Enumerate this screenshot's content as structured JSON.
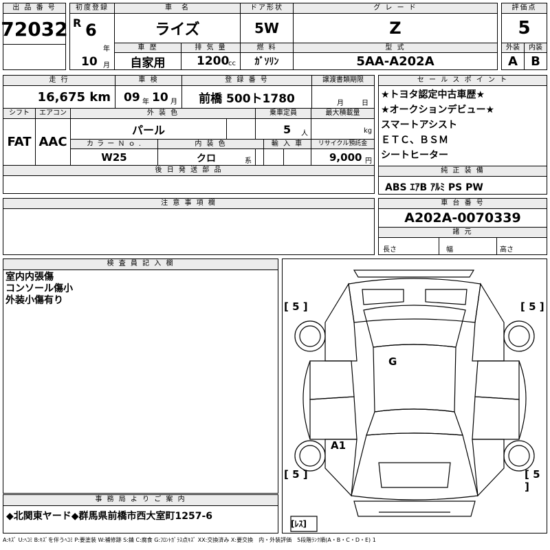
{
  "h": {
    "lot_label": "出 品 番 号",
    "lot": "72032",
    "first_reg_label": "初度登録",
    "era": "R",
    "year": "6",
    "year_unit": "年",
    "month": "10",
    "month_unit": "月",
    "car_name_label": "車　名",
    "car_name": "ライズ",
    "door_label": "ドア形状",
    "door": "5W",
    "grade_label": "グ レ ー ド",
    "grade": "Z",
    "score_label": "評価点",
    "score": "5",
    "history_label": "車 歴",
    "history": "自家用",
    "disp_label": "排 気 量",
    "disp": "1200",
    "disp_unit": "cc",
    "fuel_label": "燃 料",
    "fuel": "ｶﾞｿﾘﾝ",
    "model_label": "型 式",
    "model": "5AA-A202A",
    "ext_label": "外装",
    "ext": "A",
    "int_label": "内装",
    "int": "B"
  },
  "r2": {
    "mileage_label": "走 行",
    "mileage": "16,675 km",
    "inspect_label": "車 検",
    "inspect_y": "09",
    "inspect_yu": "年",
    "inspect_m": "10",
    "inspect_mu": "月",
    "plate_label": "登 録 番 号",
    "plate": "前橋 500ト1780",
    "transfer_label": "譲渡書類期限",
    "transfer_m": "月",
    "transfer_d": "日",
    "shift_label": "シフト",
    "shift": "FAT",
    "ac_label": "エアコン",
    "ac": "AAC",
    "color_label": "外 装 色",
    "color": "パール",
    "cap_label": "乗車定員",
    "cap": "5",
    "cap_unit": "人",
    "load_label": "最大積載量",
    "load_unit": "kg",
    "colorno_label": "カ ラ ー Ｎ ｏ .",
    "colorno": "W25",
    "intcolor_label": "内 装 色",
    "intcolor": "クロ",
    "intcolor_unit": "系",
    "import_label": "輸 入 車",
    "recycle_label": "リサイクル預託金",
    "recycle": "9,000",
    "recycle_unit": "円",
    "later_label": "後 日 発 送 部 品",
    "notes_label": "注 意 事 項 欄"
  },
  "sp": {
    "label": "セ ー ル ス ポ イ ン ト",
    "l1": "★トヨタ認定中古車歴★",
    "l2": "★オークションデビュー★",
    "l3": "スマートアシスト",
    "l4": "ＥＴＣ、ＢＳＭ",
    "l5": "シートヒーター"
  },
  "eq": {
    "label": "純 正 装 備",
    "value": "ABS ｴｱB ｱﾙﾐ PS PW"
  },
  "vin": {
    "label": "車 台 番 号",
    "value": "A202A-0070339",
    "dims_label": "諸 元",
    "length": "長さ",
    "width": "幅",
    "height": "高さ"
  },
  "insp": {
    "label": "検 査 員 記 入 欄",
    "l1": "室内内張傷",
    "l2": "コンソール傷小",
    "l3": "外装小傷有り"
  },
  "dia": {
    "tl": "[ 5 ]",
    "tr": "[ 5 ]",
    "bl": "[ 5 ]",
    "br": "[ 5 ]",
    "g": "G",
    "a1": "A1",
    "spare": "[ﾚｽ]"
  },
  "office": {
    "label": "事 務 局 よ り ご 案 内",
    "value": "◆北関東ヤード◆群馬県前橋市西大室町1257-6"
  },
  "legend": "A:ｷｽﾞ U:ﾍｺﾐ B:ｷｽﾞを伴うﾍｺﾐ P:要塗装 W:補修跡 S:錆 C:腐食 G:ﾌﾛﾝﾄｶﾞﾗｽ点ｷｽﾞ XX:交換済み X:要交換　内・外装評価　5段階ﾗﾝｸ順(A・B・C・D・E) 1"
}
